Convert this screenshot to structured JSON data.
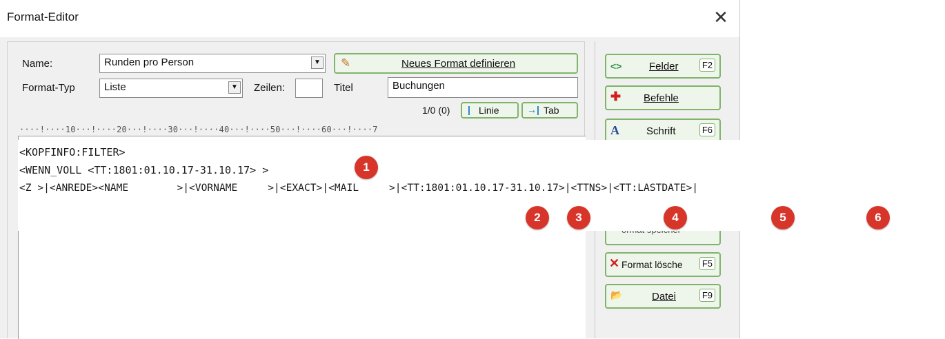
{
  "window": {
    "title": "Format-Editor",
    "close_glyph": "✕"
  },
  "form": {
    "name_label": "Name:",
    "name_value": "Runden pro Person",
    "new_format_label": "Neues Format definieren",
    "type_label": "Format-Typ",
    "type_value": "Liste",
    "lines_label": "Zeilen:",
    "lines_value": "",
    "title_label": "Titel",
    "title_value": "Buchungen",
    "position": "1/0 (0)",
    "line_button": "Linie",
    "tab_button": "Tab"
  },
  "ruler": "····!····10···!····20···!····30···!····40···!····50···!····60···!····7",
  "editor": {
    "lines": [
      "<KOPFINFO:FILTER>",
      "<WENN_VOLL <TT:1801:01.10.17-31.10.17> >",
      "<Z >|<ANREDE><NAME        >|<VORNAME     >|<EXACT>|<MAIL     >|<TT:1801:01.10.17-31.10.17>|<TTNS>|<TT:LASTDATE>|"
    ]
  },
  "badges": [
    "1",
    "2",
    "3",
    "4",
    "5",
    "6"
  ],
  "sidebar": {
    "fields": {
      "icon": "<>",
      "label": "Felder",
      "key": "F2"
    },
    "commands": {
      "icon": "✚",
      "label": "Befehle"
    },
    "font": {
      "icon": "A",
      "label": "Schrift",
      "key": "F6"
    },
    "partial": {
      "label": "ormat speicher"
    },
    "delete": {
      "icon": "✕",
      "label": "Format lösche",
      "key": "F5"
    },
    "file": {
      "icon": "📂",
      "label": "Datei",
      "key": "F9"
    }
  },
  "colors": {
    "badge": "#d8352a",
    "button_border": "#7fb46a",
    "button_bg": "#eef5ea"
  }
}
